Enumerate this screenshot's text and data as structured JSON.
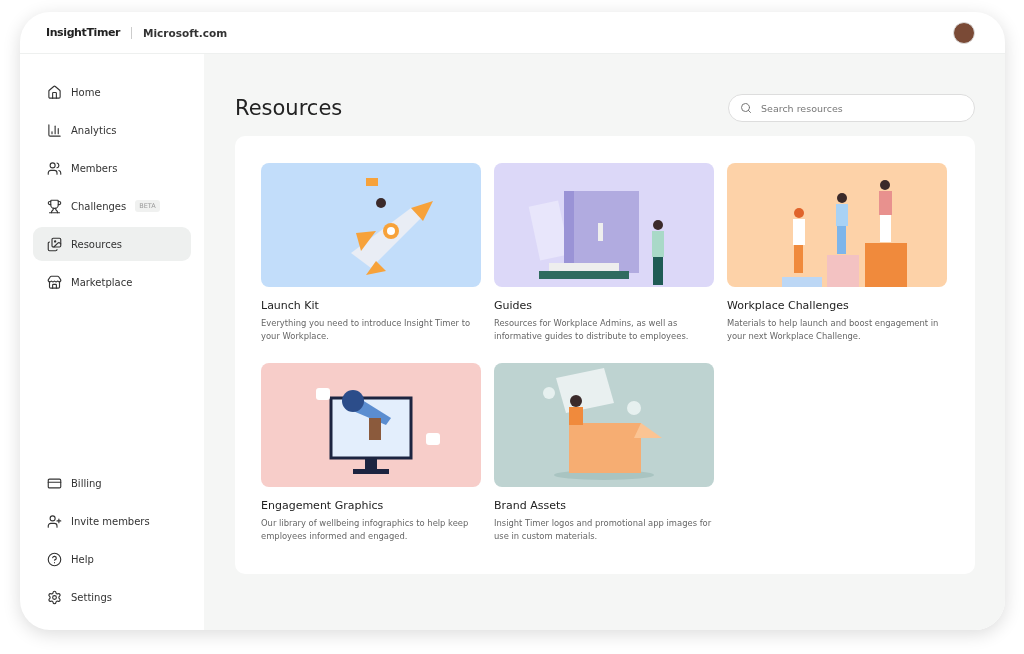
{
  "header": {
    "brand": "InsightTimer",
    "org": "Microsoft.com"
  },
  "sidebar": {
    "items": [
      {
        "label": "Home",
        "selected": false
      },
      {
        "label": "Analytics",
        "selected": false
      },
      {
        "label": "Members",
        "selected": false
      },
      {
        "label": "Challenges",
        "badge": "BETA",
        "selected": false
      },
      {
        "label": "Resources",
        "selected": true
      },
      {
        "label": "Marketplace",
        "selected": false
      }
    ],
    "footer_items": [
      {
        "label": "Billing"
      },
      {
        "label": "Invite members"
      },
      {
        "label": "Help"
      },
      {
        "label": "Settings"
      }
    ]
  },
  "page": {
    "title": "Resources",
    "search": {
      "placeholder": "Search resources"
    }
  },
  "cards": [
    {
      "title": "Launch Kit",
      "description": "Everything you need to introduce Insight Timer to your Workplace.",
      "kind": "rocket",
      "color": "#c2ddfa"
    },
    {
      "title": "Guides",
      "description": "Resources for Workplace Admins, as well as informative guides to distribute to employees.",
      "kind": "book",
      "color": "#dcd8f8"
    },
    {
      "title": "Workplace Challenges",
      "description": "Materials to help launch and boost engagement in your next Workplace Challenge.",
      "kind": "steps",
      "color": "#fdd2a8"
    },
    {
      "title": "Engagement Graphics",
      "description": "Our library of wellbeing infographics to help keep employees informed and engaged.",
      "kind": "megaphone",
      "color": "#f7cdc9"
    },
    {
      "title": "Brand Assets",
      "description": "Insight Timer logos and promotional app images for use in custom materials.",
      "kind": "box",
      "color": "#bed3d1"
    }
  ]
}
